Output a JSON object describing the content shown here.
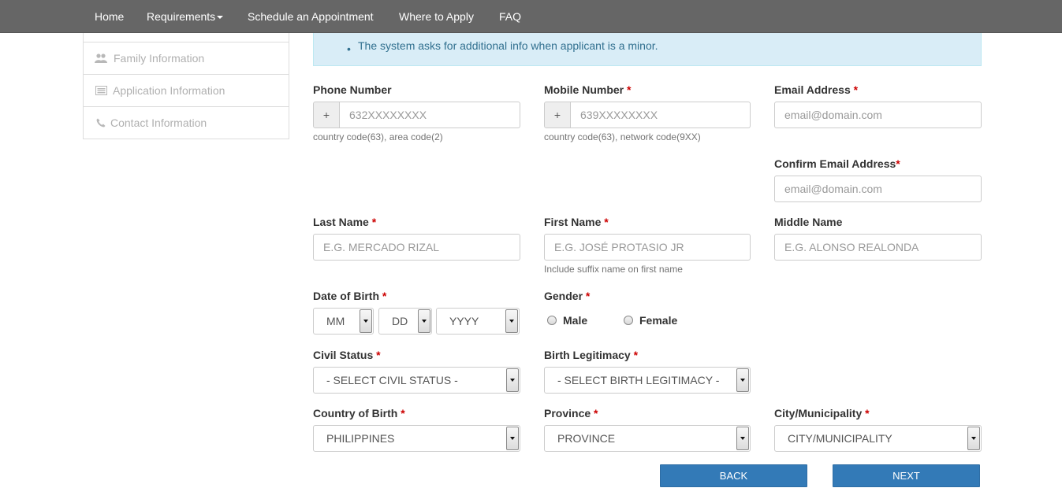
{
  "nav": {
    "home": "Home",
    "requirements": "Requirements",
    "schedule": "Schedule an Appointment",
    "where": "Where to Apply",
    "faq": "FAQ"
  },
  "sidebar": {
    "items": [
      {
        "label": "Family Information",
        "icon": "users-icon"
      },
      {
        "label": "Application Information",
        "icon": "list-icon"
      },
      {
        "label": "Contact Information",
        "icon": "phone-icon"
      }
    ]
  },
  "alert": {
    "text": "The system asks for additional info when applicant is a minor."
  },
  "form": {
    "phone": {
      "label": "Phone Number",
      "prefix": "+",
      "placeholder": "632XXXXXXXX",
      "help": "country code(63), area code(2)"
    },
    "mobile": {
      "label": "Mobile Number",
      "prefix": "+",
      "placeholder": "639XXXXXXXX",
      "help": "country code(63), network code(9XX)"
    },
    "email": {
      "label": "Email Address",
      "placeholder": "email@domain.com"
    },
    "confirm_email": {
      "label": "Confirm Email Address",
      "placeholder": "email@domain.com"
    },
    "last_name": {
      "label": "Last Name",
      "placeholder": "E.G. MERCADO RIZAL"
    },
    "first_name": {
      "label": "First Name",
      "placeholder": "E.G. JOSÉ PROTASIO JR",
      "help": "Include suffix name on first name"
    },
    "middle_name": {
      "label": "Middle Name",
      "placeholder": "E.G. ALONSO REALONDA"
    },
    "dob": {
      "label": "Date of Birth",
      "mm": "MM",
      "dd": "DD",
      "yyyy": "YYYY"
    },
    "gender": {
      "label": "Gender",
      "male": "Male",
      "female": "Female"
    },
    "civil_status": {
      "label": "Civil Status",
      "value": "- SELECT CIVIL STATUS -"
    },
    "birth_legitimacy": {
      "label": "Birth Legitimacy",
      "value": "- SELECT BIRTH LEGITIMACY -"
    },
    "country_of_birth": {
      "label": "Country of Birth",
      "value": "PHILIPPINES"
    },
    "province": {
      "label": "Province",
      "value": "PROVINCE"
    },
    "city": {
      "label": "City/Municipality",
      "value": "CITY/MUNICIPALITY"
    },
    "required_mark": "*"
  },
  "buttons": {
    "back": "BACK",
    "next": "NEXT"
  },
  "colors": {
    "navbar": "#666666",
    "primary": "#337ab7",
    "alert_bg": "#d9edf7",
    "required": "#cc0000"
  }
}
